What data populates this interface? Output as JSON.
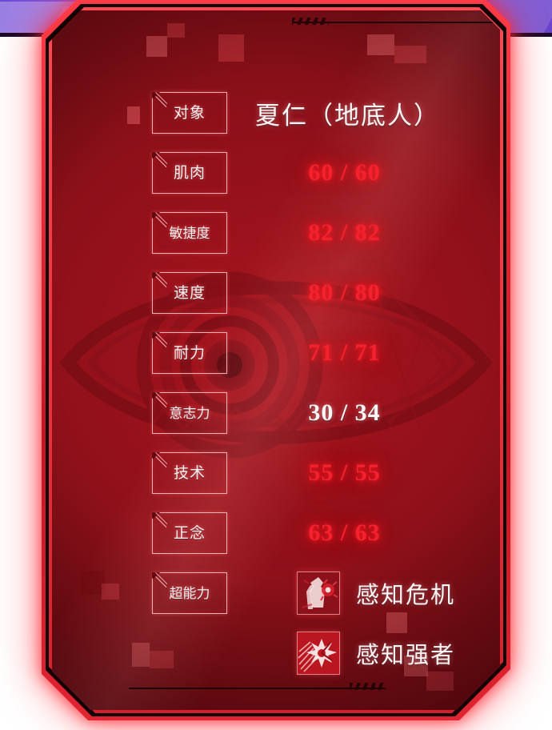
{
  "panel": {
    "theme_color": "#a8141e",
    "accent_red": "#f5222e",
    "text_white": "#fdf6f6",
    "border_pink": "#ffbec3"
  },
  "header": {
    "label": "对象",
    "value": "夏仁（地底人）"
  },
  "stats": [
    {
      "label": "肌肉",
      "value": "60 / 60",
      "color": "red"
    },
    {
      "label": "敏捷度",
      "value": "82 / 82",
      "color": "red"
    },
    {
      "label": "速度",
      "value": "80 / 80",
      "color": "red"
    },
    {
      "label": "耐力",
      "value": "71 / 71",
      "color": "red"
    },
    {
      "label": "意志力",
      "value": "30 / 34",
      "color": "white"
    },
    {
      "label": "技术",
      "value": "55 / 55",
      "color": "red"
    },
    {
      "label": "正念",
      "value": "63 / 63",
      "color": "red"
    }
  ],
  "powers": {
    "label": "超能力",
    "items": [
      {
        "name": "感知危机",
        "icon": "figure-sense-danger-icon"
      },
      {
        "name": "感知强者",
        "icon": "burst-sense-strong-icon"
      }
    ]
  },
  "background": {
    "watermark": "eye-mandala-watermark"
  }
}
